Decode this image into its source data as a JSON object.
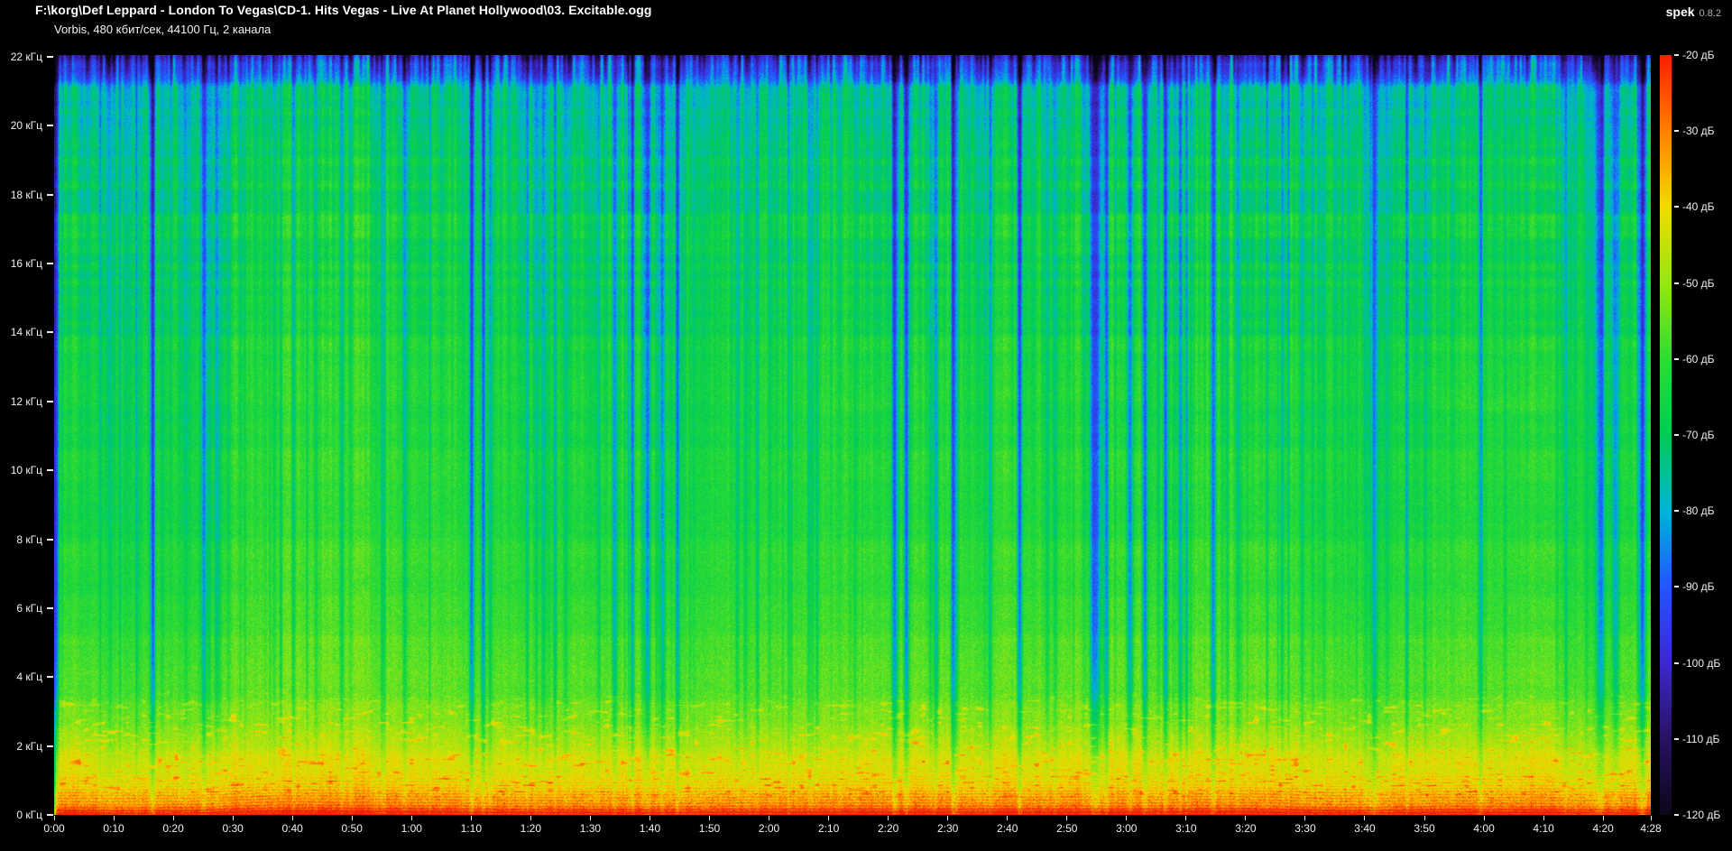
{
  "window": {
    "title": "F:\\korg\\Def Leppard - London To Vegas\\CD-1. Hits Vegas - Live At Planet Hollywood\\03. Excitable.ogg",
    "subtitle": "Vorbis, 480 кбит/сек, 44100 Гц, 2 канала",
    "app_name": "spek",
    "app_version": "0.8.2"
  },
  "chart_data": {
    "type": "heatmap",
    "subtype": "audio-spectrogram",
    "title": "F:\\korg\\Def Leppard - London To Vegas\\CD-1. Hits Vegas - Live At Planet Hollywood\\03. Excitable.ogg",
    "stream_info": "Vorbis, 480 кбит/сек, 44100 Гц, 2 канала",
    "duration": "4:28",
    "duration_seconds": 268,
    "x_axis": {
      "unit": "time",
      "tick_labels": [
        "0:00",
        "0:10",
        "0:20",
        "0:30",
        "0:40",
        "0:50",
        "1:00",
        "1:10",
        "1:20",
        "1:30",
        "1:40",
        "1:50",
        "2:00",
        "2:10",
        "2:20",
        "2:30",
        "2:40",
        "2:50",
        "3:00",
        "3:10",
        "3:20",
        "3:30",
        "3:40",
        "3:50",
        "4:00",
        "4:10",
        "4:20",
        "4:28"
      ]
    },
    "y_axis": {
      "unit": "кГц",
      "range_khz": [
        0,
        22.05
      ],
      "tick_labels": [
        "22 кГц",
        "20 кГц",
        "18 кГц",
        "16 кГц",
        "14 кГц",
        "12 кГц",
        "10 кГц",
        "8 кГц",
        "6 кГц",
        "4 кГц",
        "2 кГц",
        "0 кГц"
      ]
    },
    "colorbar": {
      "unit": "дБ",
      "range_db": [
        -20,
        -120
      ],
      "tick_labels": [
        "-20 дБ",
        "-30 дБ",
        "-40 дБ",
        "-50 дБ",
        "-60 дБ",
        "-70 дБ",
        "-80 дБ",
        "-90 дБ",
        "-100 дБ",
        "-110 дБ",
        "-120 дБ"
      ],
      "palette_stops": [
        {
          "db": -20,
          "color": "#fa1e00"
        },
        {
          "db": -30,
          "color": "#ff8200"
        },
        {
          "db": -40,
          "color": "#f0dc00"
        },
        {
          "db": -50,
          "color": "#96e614"
        },
        {
          "db": -60,
          "color": "#2edc32"
        },
        {
          "db": -70,
          "color": "#00cc55"
        },
        {
          "db": -80,
          "color": "#00b4d8"
        },
        {
          "db": -90,
          "color": "#2356ff"
        },
        {
          "db": -100,
          "color": "#3d28cd"
        },
        {
          "db": -110,
          "color": "#281264"
        },
        {
          "db": -120,
          "color": "#0c0618"
        },
        {
          "db": -130,
          "color": "#050310"
        }
      ]
    },
    "quiet_streaks": [
      [
        0.4,
        1.5,
        26
      ],
      [
        16.5,
        2,
        22
      ],
      [
        25,
        1.5,
        18
      ],
      [
        38,
        1.2,
        14
      ],
      [
        55,
        1.2,
        12
      ],
      [
        70,
        2,
        22
      ],
      [
        72,
        1.5,
        20
      ],
      [
        84,
        1.5,
        16
      ],
      [
        94,
        2,
        18
      ],
      [
        97,
        1.5,
        20
      ],
      [
        99.5,
        2,
        22
      ],
      [
        102,
        1.5,
        18
      ],
      [
        104.5,
        1.5,
        16
      ],
      [
        118,
        1.2,
        12
      ],
      [
        128,
        1.2,
        12
      ],
      [
        141,
        2.5,
        24
      ],
      [
        143,
        2,
        26
      ],
      [
        148,
        2,
        20
      ],
      [
        151,
        2.5,
        22
      ],
      [
        157,
        1.5,
        14
      ],
      [
        162,
        2,
        24
      ],
      [
        174.8,
        4,
        26
      ],
      [
        176.5,
        2,
        20
      ],
      [
        180.5,
        2.5,
        24
      ],
      [
        183,
        2,
        22
      ],
      [
        186.5,
        2,
        26
      ],
      [
        189,
        2,
        20
      ],
      [
        194.5,
        2,
        18
      ],
      [
        206,
        1.5,
        12
      ],
      [
        230,
        1.2,
        10
      ],
      [
        259.5,
        3.5,
        22
      ],
      [
        262,
        2.5,
        18
      ],
      [
        266.5,
        2.5,
        26
      ]
    ]
  }
}
